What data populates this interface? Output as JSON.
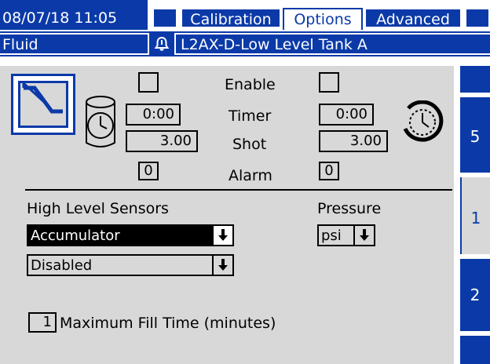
{
  "header": {
    "datetime": "08/07/18 11:05",
    "tabs": [
      {
        "label": "Calibration",
        "active": false
      },
      {
        "label": "Options",
        "active": true
      },
      {
        "label": "Advanced",
        "active": false
      }
    ],
    "screen_name": "Fluid",
    "alarm_message": "L2AX-D-Low Level Tank A"
  },
  "settings": {
    "enable_label": "Enable",
    "timer_label": "Timer",
    "shot_label": "Shot",
    "alarm_label": "Alarm",
    "left_timer": "0:00",
    "left_shot": "3.00",
    "left_alarm": "0",
    "right_timer": "0:00",
    "right_shot": "3.00",
    "right_alarm": "0"
  },
  "high_level": {
    "label": "High Level Sensors",
    "sensor_selected": "Accumulator",
    "sensor_mode": "Disabled"
  },
  "pressure": {
    "label": "Pressure",
    "unit_selected": "psi"
  },
  "fill_time": {
    "value": "1",
    "label": "Maximum Fill Time (minutes)"
  },
  "sidebar": {
    "buttons": [
      "5",
      "1",
      "2"
    ]
  },
  "colors": {
    "accent_blue": "#0b3aa8",
    "panel_gray": "#d8d8d8",
    "header_text": "#ffffff"
  }
}
